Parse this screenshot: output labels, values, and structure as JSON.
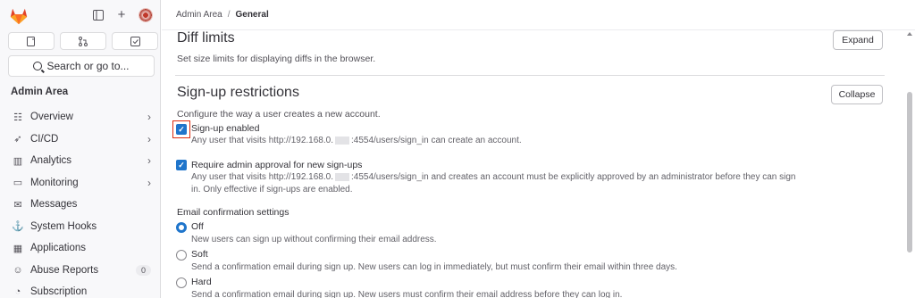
{
  "sidebar": {
    "search_label": "Search or go to...",
    "section_title": "Admin Area",
    "items": [
      {
        "label": "Overview",
        "icon": "overview-icon",
        "glyph": "☷",
        "chevron": true
      },
      {
        "label": "CI/CD",
        "icon": "rocket-icon",
        "glyph": "➶",
        "chevron": true
      },
      {
        "label": "Analytics",
        "icon": "chart-icon",
        "glyph": "▥",
        "chevron": true
      },
      {
        "label": "Monitoring",
        "icon": "monitor-icon",
        "glyph": "▭",
        "chevron": true
      },
      {
        "label": "Messages",
        "icon": "megaphone-icon",
        "glyph": "✉",
        "chevron": false
      },
      {
        "label": "System Hooks",
        "icon": "hook-icon",
        "glyph": "⚓",
        "chevron": false
      },
      {
        "label": "Applications",
        "icon": "applications-icon",
        "glyph": "▦",
        "chevron": false
      },
      {
        "label": "Abuse Reports",
        "icon": "abuse-icon",
        "glyph": "☺",
        "chevron": false,
        "badge": "0"
      },
      {
        "label": "Subscription",
        "icon": "subscription-icon",
        "glyph": "◔",
        "chevron": false
      }
    ]
  },
  "breadcrumb": {
    "parent": "Admin Area",
    "separator": "/",
    "current": "General"
  },
  "diff_limits": {
    "title": "Diff limits",
    "description": "Set size limits for displaying diffs in the browser.",
    "button": "Expand"
  },
  "signup": {
    "title": "Sign-up restrictions",
    "description": "Configure the way a user creates a new account.",
    "button": "Collapse",
    "signup_enabled": {
      "label": "Sign-up enabled",
      "checked": true,
      "help_a": "Any user that visits http://192.168.0.",
      "help_b": ":4554/users/sign_in can create an account."
    },
    "admin_approval": {
      "label": "Require admin approval for new sign-ups",
      "checked": true,
      "help_a": "Any user that visits http://192.168.0.",
      "help_b": ":4554/users/sign_in and creates an account must be explicitly approved by an administrator before they can sign",
      "help_c": "in. Only effective if sign-ups are enabled."
    },
    "email_confirmation": {
      "title": "Email confirmation settings",
      "selected": "Off",
      "options": [
        {
          "label": "Off",
          "help": "New users can sign up without confirming their email address."
        },
        {
          "label": "Soft",
          "help": "Send a confirmation email during sign up. New users can log in immediately, but must confirm their email within three days."
        },
        {
          "label": "Hard",
          "help": "Send a confirmation email during sign up. New users must confirm their email address before they can log in."
        }
      ]
    }
  },
  "colors": {
    "accent": "#1f75cb",
    "highlight": "#dd2b0e",
    "brand": "#e24329"
  }
}
